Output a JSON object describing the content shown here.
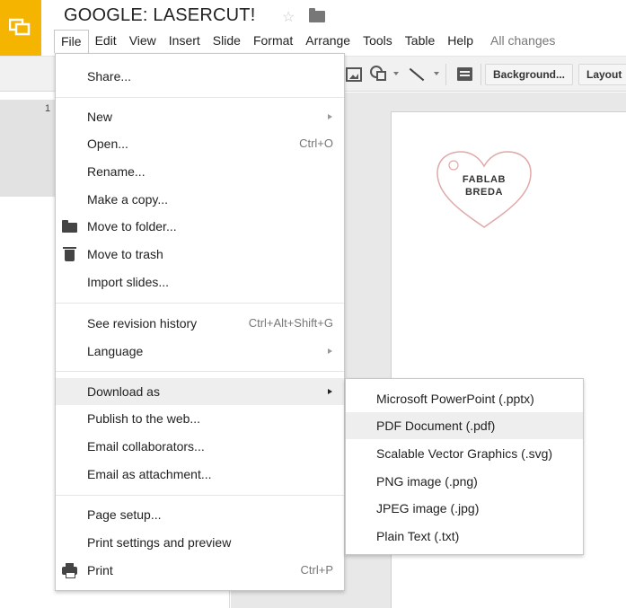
{
  "app": {
    "title": "GOOGLE: LASERCUT!",
    "brand_color": "#f4b400"
  },
  "menubar": {
    "items": [
      "File",
      "Edit",
      "View",
      "Insert",
      "Slide",
      "Format",
      "Arrange",
      "Tools",
      "Table",
      "Help"
    ],
    "status": "All changes"
  },
  "toolbar": {
    "background_label": "Background...",
    "layout_label": "Layout"
  },
  "filmstrip": {
    "slide_number": "1"
  },
  "slide": {
    "heart_line1": "FABLAB",
    "heart_line2": "BREDA"
  },
  "file_menu": {
    "share": "Share...",
    "new": "New",
    "open": "Open...",
    "open_shortcut": "Ctrl+O",
    "rename": "Rename...",
    "make_copy": "Make a copy...",
    "move_folder": "Move to folder...",
    "move_trash": "Move to trash",
    "import_slides": "Import slides...",
    "revision_history": "See revision history",
    "revision_shortcut": "Ctrl+Alt+Shift+G",
    "language": "Language",
    "download_as": "Download as",
    "publish_web": "Publish to the web...",
    "email_collaborators": "Email collaborators...",
    "email_attachment": "Email as attachment...",
    "page_setup": "Page setup...",
    "print_settings": "Print settings and preview",
    "print": "Print",
    "print_shortcut": "Ctrl+P"
  },
  "download_menu": {
    "items": [
      "Microsoft PowerPoint (.pptx)",
      "PDF Document (.pdf)",
      "Scalable Vector Graphics (.svg)",
      "PNG image (.png)",
      "JPEG image (.jpg)",
      "Plain Text (.txt)"
    ]
  }
}
